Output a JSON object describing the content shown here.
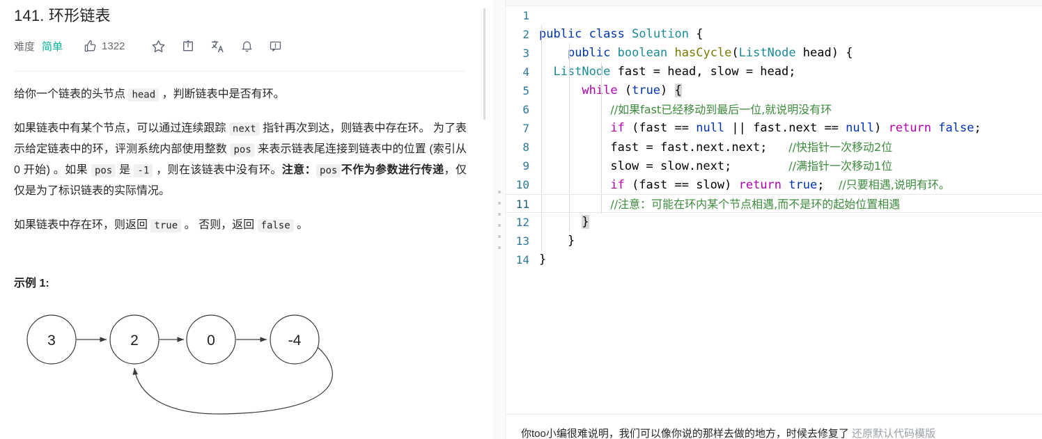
{
  "problem": {
    "title": "141. 环形链表",
    "difficulty_label": "难度",
    "difficulty": "简单",
    "vote_count": "1322",
    "icons": [
      {
        "name": "thumbs-up-icon",
        "label": "点赞"
      },
      {
        "name": "star-icon",
        "label": "收藏"
      },
      {
        "name": "share-icon",
        "label": "分享"
      },
      {
        "name": "translate-icon",
        "label": "切换语言"
      },
      {
        "name": "bell-icon",
        "label": "订阅"
      },
      {
        "name": "feedback-icon",
        "label": "反馈"
      }
    ],
    "paragraphs": {
      "p1_a": "给你一个链表的头节点 ",
      "p1_code": "head",
      "p1_b": " ，判断链表中是否有环。",
      "p2_a": "如果链表中有某个节点，可以通过连续跟踪 ",
      "p2_code1": "next",
      "p2_b": " 指针再次到达，则链表中存在环。 为了表示给定链表中的环，评测系统内部使用整数 ",
      "p2_code2": "pos",
      "p2_c": " 来表示链表尾连接到链表中的位置 (索引从 0 开始) 。如果 ",
      "p2_code3": "pos",
      "p2_d": " 是 ",
      "p2_code4": "-1",
      "p2_e": " ，则在该链表中没有环。",
      "p2_bold1": "注意：",
      "p2_code5": "pos",
      "p2_bold2": "不作为参数进行传递",
      "p2_f": "，仅仅是为了标识链表的实际情况。",
      "p3_a": "如果链表中存在环，则返回 ",
      "p3_code1": "true",
      "p3_b": " 。 否则，返回 ",
      "p3_code2": "false",
      "p3_c": " 。"
    },
    "example_title": "示例 1:",
    "diagram": {
      "nodes": [
        "3",
        "2",
        "0",
        "-4"
      ],
      "cycle_from": "-4",
      "cycle_to": "2"
    }
  },
  "editor": {
    "language": "java",
    "active_line": 11,
    "lines": [
      {
        "n": "1",
        "tokens": []
      },
      {
        "n": "2",
        "tokens": [
          {
            "t": "public",
            "c": "kw"
          },
          {
            "t": " ",
            "c": "plain"
          },
          {
            "t": "class",
            "c": "kw"
          },
          {
            "t": " ",
            "c": "plain"
          },
          {
            "t": "Solution",
            "c": "type"
          },
          {
            "t": " {",
            "c": "plain"
          }
        ]
      },
      {
        "n": "3",
        "tokens": [
          {
            "t": "    ",
            "c": "plain"
          },
          {
            "t": "public",
            "c": "kw"
          },
          {
            "t": " ",
            "c": "plain"
          },
          {
            "t": "boolean",
            "c": "type"
          },
          {
            "t": " ",
            "c": "plain"
          },
          {
            "t": "hasCycle",
            "c": "fn"
          },
          {
            "t": "(",
            "c": "plain"
          },
          {
            "t": "ListNode",
            "c": "type"
          },
          {
            "t": " head) {",
            "c": "plain"
          }
        ]
      },
      {
        "n": "4",
        "tokens": [
          {
            "t": "  ",
            "c": "plain"
          },
          {
            "t": "ListNode",
            "c": "type"
          },
          {
            "t": " fast = head, slow = head;",
            "c": "plain"
          }
        ]
      },
      {
        "n": "5",
        "tokens": [
          {
            "t": "      ",
            "c": "plain"
          },
          {
            "t": "while",
            "c": "kw2"
          },
          {
            "t": " (",
            "c": "plain"
          },
          {
            "t": "true",
            "c": "kw"
          },
          {
            "t": ") ",
            "c": "plain"
          },
          {
            "t": "{",
            "c": "brk-hl"
          }
        ]
      },
      {
        "n": "6",
        "tokens": [
          {
            "t": "          ",
            "c": "plain"
          },
          {
            "t": "//如果fast已经移动到最后一位,就说明没有环",
            "c": "cmt-cn"
          }
        ]
      },
      {
        "n": "7",
        "tokens": [
          {
            "t": "          ",
            "c": "plain"
          },
          {
            "t": "if",
            "c": "kw2"
          },
          {
            "t": " (fast == ",
            "c": "plain"
          },
          {
            "t": "null",
            "c": "kw"
          },
          {
            "t": " || fast.next == ",
            "c": "plain"
          },
          {
            "t": "null",
            "c": "kw"
          },
          {
            "t": ") ",
            "c": "plain"
          },
          {
            "t": "return",
            "c": "kw2"
          },
          {
            "t": " ",
            "c": "plain"
          },
          {
            "t": "false",
            "c": "kw"
          },
          {
            "t": ";",
            "c": "plain"
          }
        ]
      },
      {
        "n": "8",
        "tokens": [
          {
            "t": "          fast = fast.next.next;   ",
            "c": "plain"
          },
          {
            "t": "//快指针一次移动2位",
            "c": "cmt-cn"
          }
        ]
      },
      {
        "n": "9",
        "tokens": [
          {
            "t": "          slow = slow.next;        ",
            "c": "plain"
          },
          {
            "t": "//满指针一次移动1位",
            "c": "cmt-cn"
          }
        ]
      },
      {
        "n": "10",
        "tokens": [
          {
            "t": "          ",
            "c": "plain"
          },
          {
            "t": "if",
            "c": "kw2"
          },
          {
            "t": " (fast == slow) ",
            "c": "plain"
          },
          {
            "t": "return",
            "c": "kw2"
          },
          {
            "t": " ",
            "c": "plain"
          },
          {
            "t": "true",
            "c": "kw"
          },
          {
            "t": ";  ",
            "c": "plain"
          },
          {
            "t": "//只要相遇,说明有环。",
            "c": "cmt-cn"
          }
        ]
      },
      {
        "n": "11",
        "tokens": [
          {
            "t": "          ",
            "c": "plain"
          },
          {
            "t": "//注意：可能在环内某个节点相遇,而不是环的起始位置相遇",
            "c": "cmt-cn"
          }
        ]
      },
      {
        "n": "12",
        "tokens": [
          {
            "t": "      ",
            "c": "plain"
          },
          {
            "t": "}",
            "c": "brk-hl"
          }
        ]
      },
      {
        "n": "13",
        "tokens": [
          {
            "t": "    }",
            "c": "plain"
          }
        ]
      },
      {
        "n": "14",
        "tokens": [
          {
            "t": "}",
            "c": "plain"
          }
        ]
      }
    ],
    "bottom_bar_text": "你too小编很难说明，我们可以像你说的那样去做的地方，时候去修复了",
    "bottom_bar_muted": "还原默认代码模版"
  },
  "colors": {
    "difficulty_green": "#00af9b",
    "keyword_blue": "#0033b3",
    "keyword_magenta": "#b000b0",
    "type_teal": "#1b8a96",
    "function_olive": "#7a7a00",
    "comment_green": "#3d8b3d",
    "line_number": "#2b7a9b",
    "text": "#262626"
  }
}
